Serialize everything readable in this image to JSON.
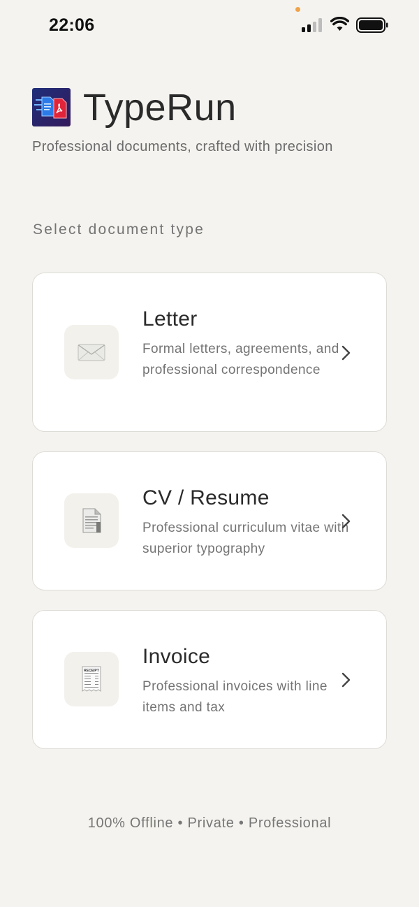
{
  "status_bar": {
    "time": "22:06"
  },
  "header": {
    "title": "TypeRun",
    "subtitle": "Professional documents, crafted with precision",
    "logo_icon": "typerun-logo-icon"
  },
  "section_label": "Select document type",
  "cards": [
    {
      "title": "Letter",
      "description": "Formal letters, agreements, and professional correspondence",
      "icon": "envelope-icon"
    },
    {
      "title": "CV / Resume",
      "description": "Professional curriculum vitae with superior typography",
      "icon": "document-icon"
    },
    {
      "title": "Invoice",
      "description": "Professional invoices with line items and tax",
      "icon": "receipt-icon",
      "icon_label": "RECEIPT"
    }
  ],
  "footer": "100% Offline • Private • Professional",
  "colors": {
    "background": "#f4f3ef",
    "card": "#ffffff",
    "accent_dot": "#f0a24a"
  }
}
